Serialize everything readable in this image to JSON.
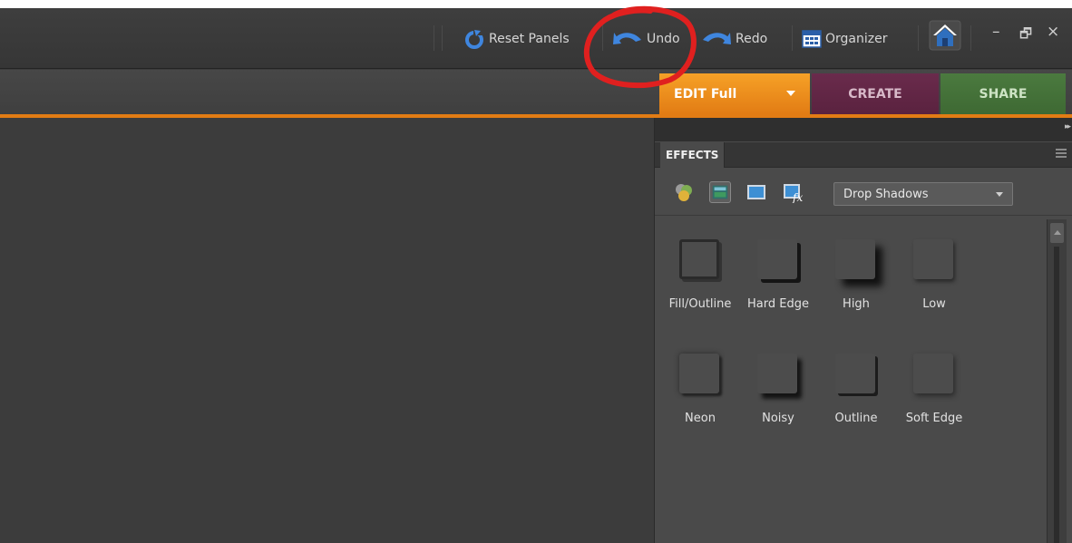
{
  "toolbar": {
    "reset_panels": "Reset Panels",
    "undo": "Undo",
    "redo": "Redo",
    "organizer": "Organizer"
  },
  "window_controls": {
    "minimize": "–",
    "restore": "🗗",
    "close": "×"
  },
  "modes": {
    "edit": "EDIT Full",
    "create": "CREATE",
    "share": "SHARE"
  },
  "panel": {
    "tab": "EFFECTS",
    "category_dropdown": "Drop Shadows",
    "effects": [
      {
        "label": "Fill/Outline"
      },
      {
        "label": "Hard Edge"
      },
      {
        "label": "High"
      },
      {
        "label": "Low"
      },
      {
        "label": "Neon"
      },
      {
        "label": "Noisy"
      },
      {
        "label": "Outline"
      },
      {
        "label": "Soft Edge"
      }
    ]
  },
  "colors": {
    "edit_tab": "#e27c14",
    "create_tab": "#5a223f",
    "share_tab": "#3e6933",
    "annotation": "#e0201f"
  }
}
